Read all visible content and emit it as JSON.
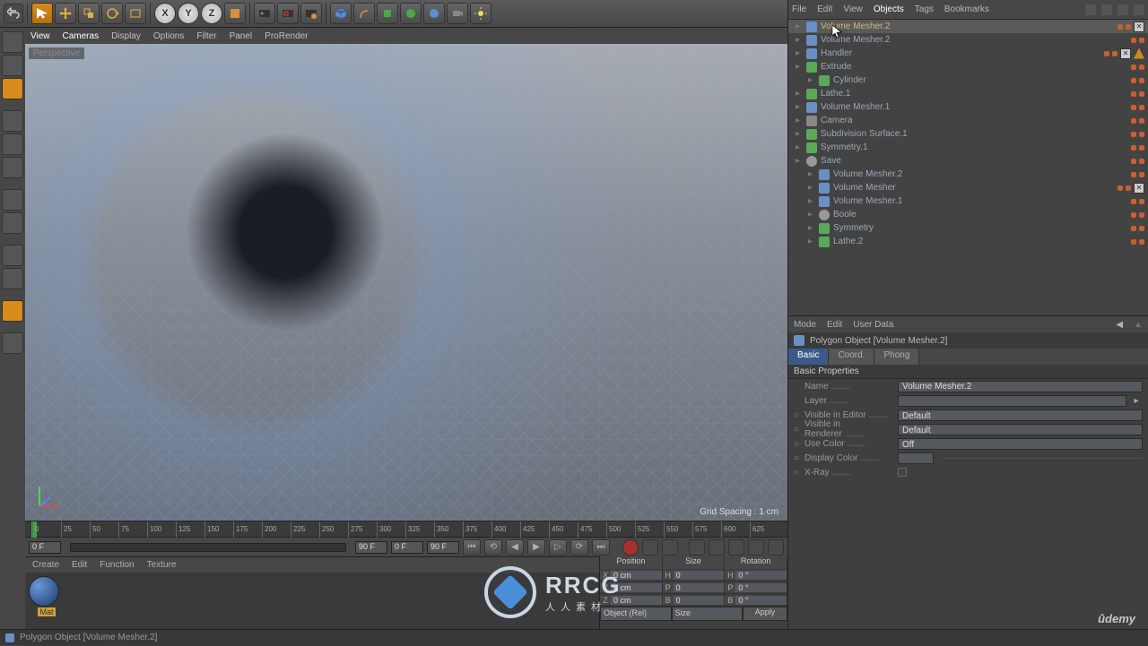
{
  "top_toolbar": {
    "axis_buttons": [
      "X",
      "Y",
      "Z"
    ]
  },
  "viewport": {
    "menu": [
      "View",
      "Cameras",
      "Display",
      "Options",
      "Filter",
      "Panel",
      "ProRender"
    ],
    "label": "Perspective",
    "grid_spacing": "Grid Spacing : 1 cm"
  },
  "object_manager": {
    "menu": [
      "File",
      "Edit",
      "View",
      "Objects",
      "Tags",
      "Bookmarks"
    ],
    "active_menu": "Objects",
    "tree": [
      {
        "indent": 0,
        "icon": "mesh",
        "name": "Volume Mesher.2",
        "sel": true,
        "flags": [
          "dot",
          "dot",
          "box"
        ]
      },
      {
        "indent": 0,
        "icon": "mesh",
        "name": "Volume Mesher.2",
        "flags": [
          "dot",
          "dot"
        ]
      },
      {
        "indent": 0,
        "icon": "mesh",
        "name": "Handler",
        "flags": [
          "dot",
          "dot",
          "box",
          "warn"
        ]
      },
      {
        "indent": 0,
        "icon": "green",
        "name": "Extrude",
        "flags": [
          "dot",
          "dot"
        ]
      },
      {
        "indent": 1,
        "icon": "green",
        "name": "Cylinder",
        "flags": [
          "dot",
          "dot"
        ]
      },
      {
        "indent": 0,
        "icon": "green",
        "name": "Lathe.1",
        "flags": [
          "dot",
          "dot"
        ]
      },
      {
        "indent": 0,
        "icon": "mesh",
        "name": "Volume Mesher.1",
        "flags": [
          "dot",
          "dot"
        ]
      },
      {
        "indent": 0,
        "icon": "cam",
        "name": "Camera",
        "flags": [
          "dot",
          "dot"
        ]
      },
      {
        "indent": 0,
        "icon": "green",
        "name": "Subdivision Surface.1",
        "flags": [
          "dot",
          "dot"
        ]
      },
      {
        "indent": 0,
        "icon": "green",
        "name": "Symmetry.1",
        "flags": [
          "dot",
          "dot"
        ]
      },
      {
        "indent": 0,
        "icon": "null",
        "name": "Save",
        "flags": [
          "dot",
          "dot"
        ]
      },
      {
        "indent": 1,
        "icon": "mesh",
        "name": "Volume Mesher.2",
        "flags": [
          "dot",
          "dot"
        ]
      },
      {
        "indent": 1,
        "icon": "mesh",
        "name": "Volume Mesher",
        "flags": [
          "dot",
          "dot",
          "box"
        ]
      },
      {
        "indent": 1,
        "icon": "mesh",
        "name": "Volume Mesher.1",
        "flags": [
          "dot",
          "dot"
        ]
      },
      {
        "indent": 1,
        "icon": "null",
        "name": "Boole",
        "flags": [
          "dot",
          "dot"
        ]
      },
      {
        "indent": 1,
        "icon": "green",
        "name": "Symmetry",
        "flags": [
          "dot",
          "dot"
        ]
      },
      {
        "indent": 1,
        "icon": "green",
        "name": "Lathe.2",
        "flags": [
          "dot",
          "dot"
        ]
      }
    ]
  },
  "attributes": {
    "menu": [
      "Mode",
      "Edit",
      "User Data"
    ],
    "title": "Polygon Object [Volume Mesher.2]",
    "tabs": [
      "Basic",
      "Coord.",
      "Phong"
    ],
    "active_tab": "Basic",
    "section": "Basic Properties",
    "rows": {
      "name_label": "Name",
      "name_value": "Volume Mesher.2",
      "layer_label": "Layer",
      "layer_value": "",
      "vis_editor_label": "Visible in Editor",
      "vis_editor_value": "Default",
      "vis_renderer_label": "Visible in Renderer",
      "vis_renderer_value": "Default",
      "use_color_label": "Use Color",
      "use_color_value": "Off",
      "display_color_label": "Display Color",
      "xray_label": "X-Ray"
    }
  },
  "timeline": {
    "ticks": [
      "0",
      "25",
      "50",
      "75",
      "100",
      "125",
      "150",
      "175",
      "200",
      "225",
      "250",
      "275",
      "300",
      "325",
      "350",
      "375",
      "400",
      "425",
      "450",
      "475",
      "500",
      "525",
      "550",
      "575",
      "600",
      "625"
    ],
    "frame_start": "0 F",
    "frame_cur": "0 F",
    "frame_end": "90 F",
    "frame_max": "90 F"
  },
  "material_manager": {
    "menu": [
      "Create",
      "Edit",
      "Function",
      "Texture"
    ],
    "material_name": "Mat"
  },
  "coordinates": {
    "headers": [
      "Position",
      "Size",
      "Rotation"
    ],
    "rows": [
      {
        "ax": "X",
        "pos": "0 cm",
        "szax": "H",
        "sz": "0",
        "rotax": "H",
        "rot": "0 °"
      },
      {
        "ax": "Y",
        "pos": "0 cm",
        "szax": "P",
        "sz": "0",
        "rotax": "P",
        "rot": "0 °"
      },
      {
        "ax": "Z",
        "pos": "0 cm",
        "szax": "B",
        "sz": "0",
        "rotax": "B",
        "rot": "0 °"
      }
    ],
    "mode1": "Object (Rel)",
    "mode2": "Size",
    "apply": "Apply"
  },
  "status_bar": {
    "text": "Polygon Object [Volume Mesher.2]"
  },
  "watermark": {
    "big": "RRCG",
    "small": "人人素材"
  },
  "udemy": "ûdemy"
}
